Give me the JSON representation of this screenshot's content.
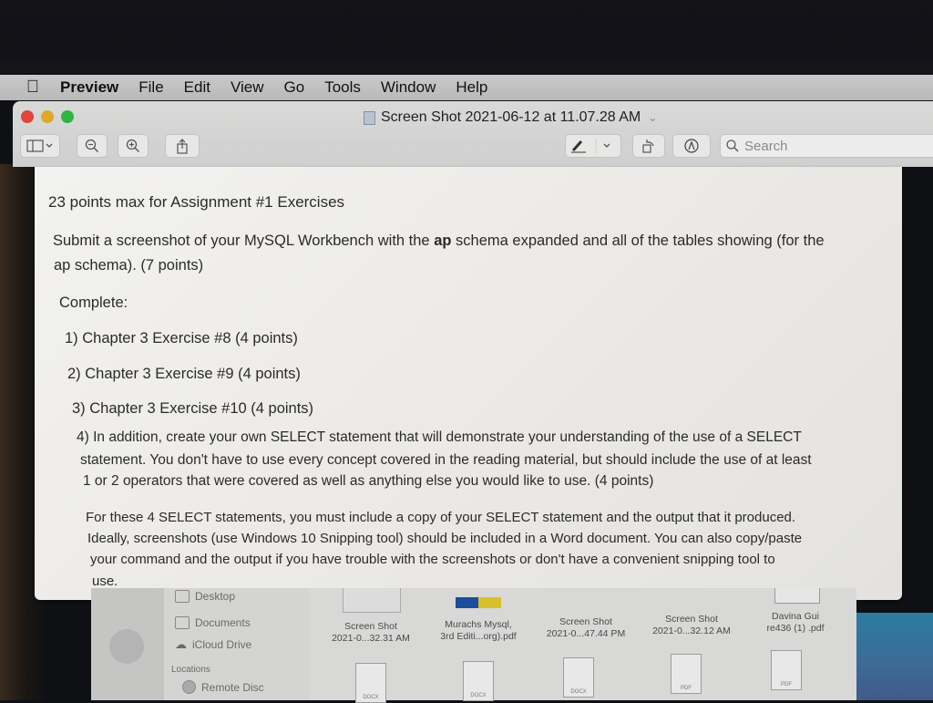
{
  "menubar": {
    "apple": "",
    "app_name": "Preview",
    "items": [
      "File",
      "Edit",
      "View",
      "Go",
      "Tools",
      "Window",
      "Help"
    ]
  },
  "window": {
    "title": "Screen Shot 2021-06-12 at 11.07.28 AM",
    "toolbar": {
      "sidebar_toggle": "sidebar-toggle",
      "zoom_out": "zoom-out",
      "zoom_in": "zoom-in",
      "share": "share",
      "markup_pen": "markup-pen",
      "rotate": "rotate",
      "annotate": "annotate",
      "search_placeholder": "Search"
    }
  },
  "document": {
    "heading": "23 points max for Assignment #1 Exercises",
    "submit_line1_a": "Submit a screenshot of your MySQL Workbench with the ",
    "submit_line1_bold": "ap",
    "submit_line1_b": " schema expanded and all of the tables showing (for the",
    "submit_line2": "ap schema). (7 points)",
    "complete_label": "Complete:",
    "items": [
      "1) Chapter 3 Exercise #8 (4 points)",
      "2) Chapter 3 Exercise #9 (4 points)",
      "3) Chapter 3 Exercise #10 (4 points)"
    ],
    "item4_lines": [
      "4) In addition, create your own SELECT statement that will demonstrate your understanding of the use of a SELECT",
      "statement.  You don't have to use every concept covered in the reading material, but should include the use of at least",
      "1 or 2 operators that were covered as well as anything else you would like to use. (4 points)"
    ],
    "footer_lines": [
      "For these 4 SELECT statements, you must include a copy of your SELECT statement and the output that it produced.",
      "Ideally, screenshots (use Windows 10 Snipping tool) should be included in a Word document.  You can also copy/paste",
      "your command and the output if you have trouble with the screenshots or don't have a convenient snipping tool to",
      "use."
    ]
  },
  "finder": {
    "sidebar": {
      "desktop": "Desktop",
      "documents": "Documents",
      "icloud": "iCloud Drive",
      "locations_header": "Locations",
      "remote_disc": "Remote Disc"
    },
    "files": [
      {
        "line1": "Screen Shot",
        "line2": "2021-0...32.31 AM",
        "type": "DOCX"
      },
      {
        "line1": "Murachs Mysql,",
        "line2": "3rd Editi...org).pdf",
        "type": "DOCX"
      },
      {
        "line1": "Screen Shot",
        "line2": "2021-0...47.44 PM",
        "type": "DOCX"
      },
      {
        "line1": "Screen Shot",
        "line2": "2021-0...32.12 AM",
        "type": "PDF"
      },
      {
        "line1": "Davina Gui",
        "line2": "re436 (1) .pdf",
        "type": "PDF"
      }
    ]
  }
}
